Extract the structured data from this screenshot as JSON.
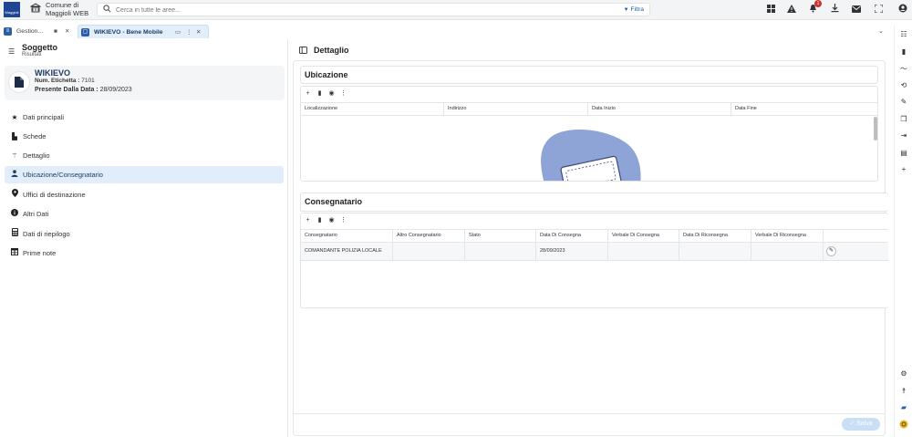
{
  "topbar": {
    "logo_text": "Maggioli",
    "app_title_line1": "Comune di",
    "app_title_line2": "Maggioli WEB",
    "search_placeholder": "Cerca in tutte le aree...",
    "filter_label": "Filtra",
    "notification_count": "1"
  },
  "tabs": [
    {
      "label": "Gestion..."
    },
    {
      "label": "WIKIEVO - Bene Mobile"
    }
  ],
  "left": {
    "title": "Soggetto",
    "subtitle": "Risultati",
    "card": {
      "name": "WIKIEVO",
      "label_num": "Num. Etichetta :",
      "value_num": "7101",
      "label_data": "Presente Dalla Data :",
      "value_data": "28/09/2023"
    },
    "menu": [
      {
        "label": "Dati principali",
        "icon": "star-icon"
      },
      {
        "label": "Schede",
        "icon": "document-icon"
      },
      {
        "label": "Dettaglio",
        "icon": "magic-wand-icon"
      },
      {
        "label": "Ubicazione/Consegnatario",
        "icon": "person-icon",
        "active": true
      },
      {
        "label": "Uffici di destinazione",
        "icon": "map-pin-icon"
      },
      {
        "label": "Altri Dati",
        "icon": "info-icon"
      },
      {
        "label": "Dati di riepilogo",
        "icon": "calculator-icon"
      },
      {
        "label": "Prime note",
        "icon": "table-icon"
      }
    ]
  },
  "main": {
    "title": "Dettaglio",
    "ubicazione": {
      "title": "Ubicazione",
      "columns": [
        "Localizzazione",
        "Indirizzo",
        "Data Inizio",
        "Data Fine"
      ]
    },
    "consegnatario": {
      "title": "Consegnatario",
      "columns": [
        "Consegnatario",
        "Altro Consegnatario",
        "Stato",
        "Data Di Consegna",
        "Verbale Di Consegna",
        "Data Di Riconsegna",
        "Verbale Di Riconsegna"
      ],
      "rows": [
        [
          "COMANDANTE POLIZIA LOCALE",
          "",
          "",
          "28/09/2023",
          "",
          "",
          ""
        ]
      ]
    },
    "save_label": "Salva"
  },
  "colors": {
    "accent": "#1f4593",
    "active_bg": "#e1edfb",
    "save_disabled": "#c9dff6",
    "badge": "#d0312d"
  }
}
